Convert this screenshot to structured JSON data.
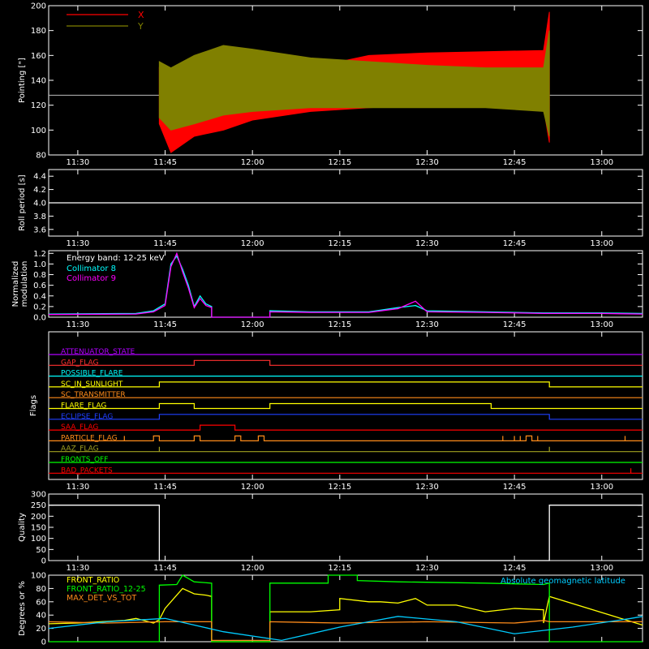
{
  "colors": {
    "background": "#000000",
    "axes": "#ffffff",
    "pointing_x": "#ff0000",
    "pointing_y": "#808000",
    "cyan": "#00ffff",
    "magenta": "#ff00ff",
    "yellow": "#ffff00",
    "green": "#00ff00",
    "orange": "#ff8c1a",
    "red": "#ff0000",
    "purple": "#b000ff",
    "blue": "#2040ff",
    "olive": "#a0a020"
  },
  "time_ticks": [
    "11:30",
    "11:45",
    "12:00",
    "12:15",
    "12:30",
    "12:45",
    "13:00"
  ],
  "chart_data": [
    {
      "type": "area",
      "panel": "pointing",
      "ylabel": "Pointing [\"]",
      "ylim": [
        80,
        200
      ],
      "yticks": [
        "80",
        "100",
        "120",
        "140",
        "160",
        "180",
        "200"
      ],
      "xlim": [
        "11:25",
        "13:07"
      ],
      "legend": [
        {
          "label": "X",
          "color": "#ff0000"
        },
        {
          "label": "Y",
          "color": "#808000"
        }
      ],
      "reference_line": 128,
      "data_start": "11:44",
      "data_end": "12:51",
      "series": [
        {
          "name": "X",
          "band": {
            "x": [
              "11:44",
              "11:46",
              "11:50",
              "11:55",
              "12:00",
              "12:10",
              "12:20",
              "12:30",
              "12:40",
              "12:50",
              "12:51"
            ],
            "upper": [
              150,
              140,
              142,
              138,
              145,
              150,
              160,
              162,
              163,
              164,
              195
            ],
            "lower": [
              105,
              82,
              95,
              100,
              108,
              115,
              118,
              120,
              120,
              118,
              90
            ]
          }
        },
        {
          "name": "Y",
          "band": {
            "x": [
              "11:44",
              "11:46",
              "11:50",
              "11:55",
              "12:00",
              "12:10",
              "12:20",
              "12:30",
              "12:40",
              "12:50",
              "12:51"
            ],
            "upper": [
              155,
              150,
              160,
              168,
              165,
              158,
              155,
              152,
              150,
              150,
              180
            ],
            "lower": [
              110,
              100,
              105,
              112,
              115,
              118,
              118,
              118,
              118,
              115,
              95
            ]
          }
        }
      ]
    },
    {
      "type": "line",
      "panel": "roll",
      "ylabel": "Roll period [s]",
      "ylim": [
        3.5,
        4.5
      ],
      "yticks": [
        "3.6",
        "3.8",
        "4.0",
        "4.2",
        "4.4"
      ],
      "series": [
        {
          "name": "",
          "x": [
            "11:25",
            "13:07"
          ],
          "y": [
            4.0,
            4.0
          ]
        }
      ]
    },
    {
      "type": "line",
      "panel": "modulation",
      "ylabel": "Normalized\nmodulation",
      "ylim": [
        0,
        1.25
      ],
      "yticks": [
        "0.0",
        "0.2",
        "0.4",
        "0.6",
        "0.8",
        "1.0",
        "1.2"
      ],
      "annotation": "Energy band: 12-25 keV",
      "series": [
        {
          "name": "Collimator 8",
          "color": "#00ffff",
          "x": [
            "11:25",
            "11:40",
            "11:43",
            "11:45",
            "11:46",
            "11:47",
            "11:48",
            "11:49",
            "11:50",
            "11:51",
            "11:52",
            "11:53",
            "11:53",
            "12:03",
            "12:03",
            "12:10",
            "12:20",
            "12:25",
            "12:28",
            "12:30",
            "12:40",
            "12:50",
            "13:00",
            "13:07"
          ],
          "y": [
            0.06,
            0.07,
            0.12,
            0.25,
            1.0,
            1.15,
            0.9,
            0.6,
            0.2,
            0.4,
            0.25,
            0.2,
            0.0,
            0.0,
            0.12,
            0.1,
            0.1,
            0.18,
            0.22,
            0.12,
            0.1,
            0.08,
            0.08,
            0.07
          ]
        },
        {
          "name": "Collimator 9",
          "color": "#ff00ff",
          "x": [
            "11:25",
            "11:40",
            "11:43",
            "11:45",
            "11:46",
            "11:47",
            "11:48",
            "11:49",
            "11:50",
            "11:51",
            "11:52",
            "11:53",
            "11:53",
            "12:03",
            "12:03",
            "12:10",
            "12:20",
            "12:25",
            "12:28",
            "12:30",
            "12:40",
            "12:50",
            "13:00",
            "13:07"
          ],
          "y": [
            0.05,
            0.06,
            0.1,
            0.22,
            0.95,
            1.2,
            0.85,
            0.55,
            0.18,
            0.35,
            0.22,
            0.18,
            0.0,
            0.0,
            0.1,
            0.09,
            0.09,
            0.16,
            0.3,
            0.1,
            0.09,
            0.07,
            0.07,
            0.06
          ]
        }
      ]
    },
    {
      "type": "step",
      "panel": "flags",
      "ylabel": "Flags",
      "series": [
        {
          "name": "ATTENUATOR_STATE",
          "color": "#b000ff",
          "transitions": []
        },
        {
          "name": "GAP_FLAG",
          "color": "#ff3030",
          "transitions": [
            "11:50",
            "12:03"
          ]
        },
        {
          "name": "POSSIBLE_FLARE",
          "color": "#00ffff",
          "transitions": []
        },
        {
          "name": "SC_IN_SUNLIGHT",
          "color": "#ffff00",
          "transitions": [
            "11:44",
            "12:51"
          ]
        },
        {
          "name": "SC_TRANSMITTER",
          "color": "#ff8c1a",
          "transitions": []
        },
        {
          "name": "FLARE_FLAG",
          "color": "#ffff00",
          "transitions": [
            "11:44",
            "11:50",
            "12:03",
            "12:41"
          ]
        },
        {
          "name": "ECLIPSE_FLAG",
          "color": "#2040ff",
          "transitions": [
            "11:44",
            "12:51"
          ]
        },
        {
          "name": "SAA_FLAG",
          "color": "#ff0000",
          "transitions": [
            "11:51",
            "11:57"
          ]
        },
        {
          "name": "PARTICLE_FLAG",
          "color": "#ff8c1a",
          "transitions": [
            "11:38",
            "11:38",
            "11:43",
            "11:44",
            "11:50",
            "11:51",
            "11:57",
            "11:58",
            "12:01",
            "12:02",
            "12:43",
            "12:43",
            "12:45",
            "12:45",
            "12:46",
            "12:46",
            "12:47",
            "12:48",
            "12:49",
            "12:49",
            "13:04",
            "13:04"
          ]
        },
        {
          "name": "AAZ_FLAG",
          "color": "#a0a020",
          "transitions": [
            "11:44",
            "11:44",
            "12:51",
            "12:51"
          ]
        },
        {
          "name": "FRONTS_OFF",
          "color": "#00ff00",
          "transitions": []
        },
        {
          "name": "BAD_PACKETS",
          "color": "#ff0000",
          "transitions": [
            "13:05",
            "13:05"
          ]
        }
      ]
    },
    {
      "type": "line",
      "panel": "quality",
      "ylabel": "Quality",
      "ylim": [
        0,
        300
      ],
      "yticks": [
        "0",
        "50",
        "100",
        "150",
        "200",
        "250",
        "300"
      ],
      "series": [
        {
          "name": "",
          "color": "#ffffff",
          "x": [
            "11:25",
            "11:44",
            "11:44",
            "12:51",
            "12:51",
            "13:07"
          ],
          "y": [
            250,
            250,
            0,
            0,
            250,
            250
          ]
        }
      ]
    },
    {
      "type": "line",
      "panel": "ratios",
      "ylabel": "Degrees or %",
      "ylim": [
        0,
        100
      ],
      "yticks": [
        "0",
        "20",
        "40",
        "60",
        "80",
        "100"
      ],
      "annotation": "Absolute geomagnetic latitude",
      "series": [
        {
          "name": "FRONT_RATIO",
          "color": "#ffff00",
          "x": [
            "11:25",
            "11:30",
            "11:38",
            "11:40",
            "11:43",
            "11:44",
            "11:45",
            "11:47",
            "11:48",
            "11:50",
            "11:52",
            "11:53",
            "11:53",
            "12:03",
            "12:03",
            "12:10",
            "12:15",
            "12:15",
            "12:20",
            "12:22",
            "12:25",
            "12:28",
            "12:30",
            "12:35",
            "12:40",
            "12:45",
            "12:50",
            "12:50",
            "12:51",
            "13:07"
          ],
          "y": [
            27,
            28,
            32,
            35,
            28,
            33,
            50,
            70,
            80,
            72,
            70,
            68,
            0,
            0,
            45,
            45,
            48,
            65,
            60,
            60,
            58,
            65,
            55,
            55,
            45,
            50,
            48,
            28,
            68,
            25
          ]
        },
        {
          "name": "FRONT_RATIO_12-25",
          "color": "#00ff00",
          "x": [
            "11:25",
            "11:30",
            "11:35",
            "11:37",
            "11:37",
            "11:44",
            "11:44",
            "11:47",
            "11:48",
            "11:50",
            "11:53",
            "11:53",
            "12:03",
            "12:03",
            "12:10",
            "12:13",
            "12:13",
            "12:18",
            "12:18",
            "12:25",
            "12:40",
            "12:50",
            "12:51",
            "12:51",
            "13:07"
          ],
          "y": [
            0,
            0,
            0,
            0,
            0,
            0,
            85,
            86,
            100,
            90,
            88,
            0,
            0,
            88,
            88,
            88,
            100,
            100,
            92,
            90,
            88,
            86,
            88,
            0,
            0
          ]
        },
        {
          "name": "MAX_DET_VS_TOT",
          "color": "#ff8c1a",
          "x": [
            "11:25",
            "11:35",
            "11:45",
            "11:53",
            "11:53",
            "12:03",
            "12:03",
            "12:15",
            "12:30",
            "12:45",
            "12:50",
            "12:51",
            "13:07"
          ],
          "y": [
            30,
            28,
            30,
            30,
            2,
            2,
            30,
            28,
            30,
            28,
            32,
            30,
            30
          ]
        },
        {
          "name": "Absolute geomagnetic latitude",
          "color": "#00ccff",
          "x": [
            "11:25",
            "11:35",
            "11:45",
            "11:55",
            "12:05",
            "12:15",
            "12:25",
            "12:35",
            "12:45",
            "12:55",
            "13:05",
            "13:07"
          ],
          "y": [
            20,
            30,
            35,
            15,
            2,
            22,
            38,
            30,
            12,
            22,
            35,
            38
          ]
        }
      ]
    }
  ]
}
